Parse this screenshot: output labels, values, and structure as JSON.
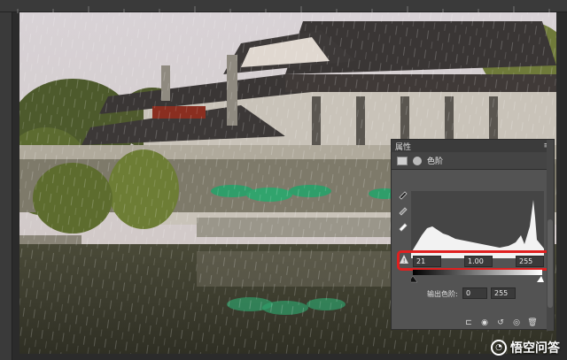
{
  "panel": {
    "title": "属性",
    "adjustment_name": "色阶",
    "levels": {
      "black_input": "21",
      "midtone_input": "1.00",
      "white_input": "255",
      "output_label": "输出色阶:",
      "output_black": "0",
      "output_white": "255"
    }
  },
  "watermark": {
    "text": "悟空问答"
  },
  "icons": [
    "eyedropper-black-icon",
    "eyedropper-gray-icon",
    "eyedropper-white-icon",
    "clip-to-layer-icon",
    "view-previous-icon",
    "reset-icon",
    "visibility-eye-icon",
    "delete-icon",
    "warning-icon"
  ],
  "colors": {
    "highlight": "#e02020",
    "panel_bg": "#535353"
  }
}
